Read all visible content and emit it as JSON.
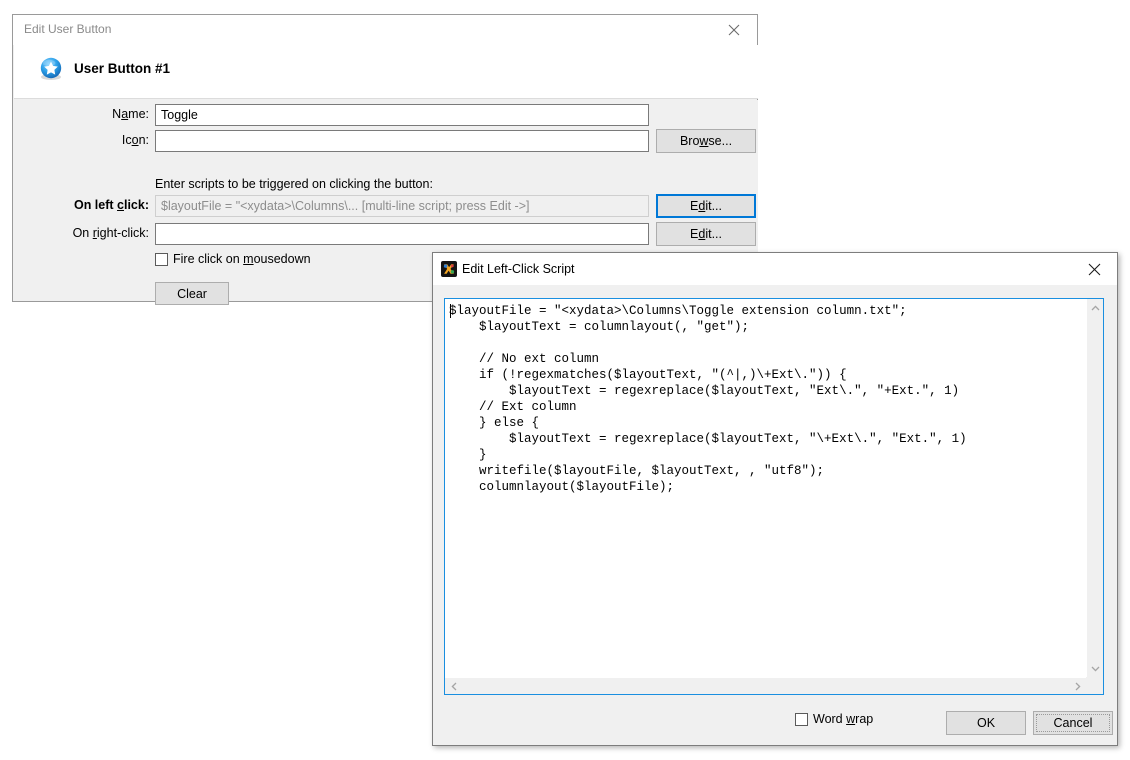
{
  "user_button_dialog": {
    "title": "Edit User Button",
    "close_icon": "close-icon",
    "header_title": "User Button #1",
    "header_icon": "blue-star-icon",
    "fields": {
      "name_label_a": "N",
      "name_label_b": "a",
      "name_label_c": "me:",
      "name_value": "Toggle",
      "icon_label_a": "Ic",
      "icon_label_b": "o",
      "icon_label_c": "n:",
      "icon_value": "",
      "browse_label_a": "Bro",
      "browse_label_b": "w",
      "browse_label_c": "se...",
      "scripts_hint": "Enter scripts to be triggered on clicking the button:",
      "left_click_label_a": "On left ",
      "left_click_label_b": "c",
      "left_click_label_c": "lick:",
      "left_click_value": "$layoutFile = \"<xydata>\\Columns\\... [multi-line script; press Edit ->]",
      "right_click_label_a": "On ",
      "right_click_label_b": "r",
      "right_click_label_c": "ight-click:",
      "right_click_value": "",
      "edit_label_a": "E",
      "edit_label_b": "d",
      "edit_label_c": "it...",
      "fire_click_label_a": "Fire click on ",
      "fire_click_label_b": "m",
      "fire_click_label_c": "ousedown",
      "fire_click_checked": false,
      "clear_label": "Clear"
    }
  },
  "script_dialog": {
    "title": "Edit Left-Click Script",
    "app_icon": "xyplorer-icon",
    "close_icon": "close-icon",
    "script_text": "$layoutFile = \"<xydata>\\Columns\\Toggle extension column.txt\";\n    $layoutText = columnlayout(, \"get\");\n\n    // No ext column\n    if (!regexmatches($layoutText, \"(^|,)\\+Ext\\.\")) {\n        $layoutText = regexreplace($layoutText, \"Ext\\.\", \"+Ext.\", 1)\n    // Ext column\n    } else {\n        $layoutText = regexreplace($layoutText, \"\\+Ext\\.\", \"Ext.\", 1)\n    }\n    writefile($layoutFile, $layoutText, , \"utf8\");\n    columnlayout($layoutFile);",
    "scroll_up_icon": "chevron-up-icon",
    "scroll_down_icon": "chevron-down-icon",
    "scroll_left_icon": "chevron-left-icon",
    "scroll_right_icon": "chevron-right-icon",
    "word_wrap_label_a": "Word ",
    "word_wrap_label_b": "w",
    "word_wrap_label_c": "rap",
    "word_wrap_checked": false,
    "ok_label": "OK",
    "cancel_label": "Cancel"
  },
  "colors": {
    "focus_blue": "#0078d7",
    "editor_border_blue": "#1a8fe0",
    "dialog_face": "#f0f0f0",
    "button_face": "#e1e1e1"
  }
}
